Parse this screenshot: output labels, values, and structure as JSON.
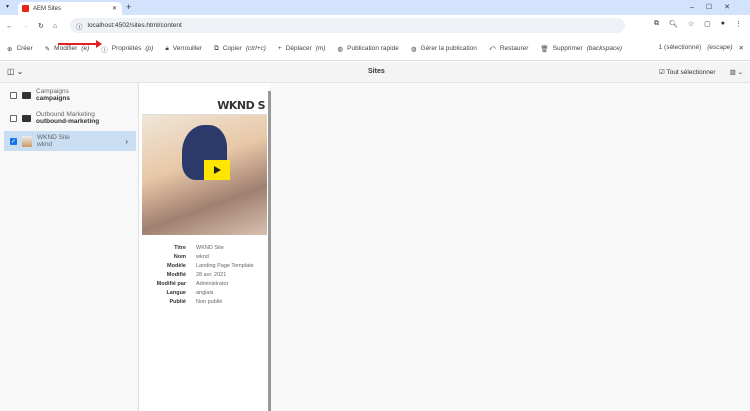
{
  "browser": {
    "tab_title": "AEM Sites",
    "url": "localhost:4502/sites.html/content"
  },
  "actions": [
    {
      "label": "Créer",
      "shortcut": "",
      "icon": "plus-circle-icon"
    },
    {
      "label": "Modifier",
      "shortcut": "(e)",
      "icon": "pencil-icon"
    },
    {
      "label": "Propriétés",
      "shortcut": "(p)",
      "icon": "info-icon"
    },
    {
      "label": "Verrouiller",
      "shortcut": "",
      "icon": "lock-icon"
    },
    {
      "label": "Copier",
      "shortcut": "(ctrl+c)",
      "icon": "copy-icon"
    },
    {
      "label": "Déplacer",
      "shortcut": "(m)",
      "icon": "move-icon"
    },
    {
      "label": "Publication rapide",
      "shortcut": "",
      "icon": "globe-icon"
    },
    {
      "label": "Gérer la publication",
      "shortcut": "",
      "icon": "globe-manage-icon"
    },
    {
      "label": "Restaurer",
      "shortcut": "",
      "icon": "restore-icon"
    },
    {
      "label": "Supprimer",
      "shortcut": "(backspace)",
      "icon": "trash-icon"
    }
  ],
  "selection": {
    "count": "1 (sélectionné)",
    "escape": "(escape)"
  },
  "header": {
    "title": "Sites",
    "select_all": "Tout sélectionner"
  },
  "items": [
    {
      "name": "Campaigns",
      "sub": "campaigns",
      "checked": false
    },
    {
      "name": "Outbound Marketing",
      "sub": "outbound-marketing",
      "checked": false
    },
    {
      "name": "WKND Site",
      "sub": "wknd",
      "checked": true
    }
  ],
  "preview": {
    "brand": "WKND S"
  },
  "properties": [
    {
      "k": "Titre",
      "v": "WKND Site"
    },
    {
      "k": "Nom",
      "v": "wknd"
    },
    {
      "k": "Modèle",
      "v": "Landing Page Template"
    },
    {
      "k": "Modifié",
      "v": "28 avr. 2021"
    },
    {
      "k": "Modifié par",
      "v": "Administrator"
    },
    {
      "k": "Langue",
      "v": "anglais"
    },
    {
      "k": "Publié",
      "v": "Non publié"
    }
  ]
}
